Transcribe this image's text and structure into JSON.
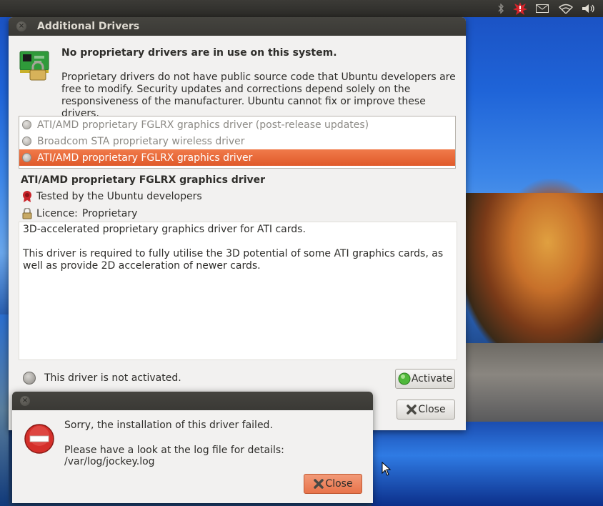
{
  "main_window": {
    "title": "Additional Drivers",
    "headline": "No proprietary drivers are in use on this system.",
    "description": "Proprietary drivers do not have public source code that Ubuntu developers are free to modify. Security updates and corrections depend solely on the responsiveness of the manufacturer. Ubuntu cannot fix or improve these drivers.",
    "drivers": [
      {
        "label": "ATI/AMD proprietary FGLRX graphics driver (post-release updates)",
        "selected": false
      },
      {
        "label": "Broadcom STA proprietary wireless driver",
        "selected": false
      },
      {
        "label": "ATI/AMD proprietary FGLRX graphics driver",
        "selected": true
      }
    ],
    "detail": {
      "title": "ATI/AMD proprietary FGLRX graphics driver",
      "tested": "Tested by the Ubuntu developers",
      "licence_label": "Licence:",
      "licence_value": "Proprietary",
      "paragraph1": "3D-accelerated proprietary graphics driver for ATI cards.",
      "paragraph2": "This driver is required to fully utilise the 3D potential of some ATI graphics cards, as well as provide 2D acceleration of newer cards."
    },
    "status_text": "This driver is not activated.",
    "activate_label": "Activate",
    "close_label": "Close"
  },
  "error_dialog": {
    "message": "Sorry, the installation of this driver failed.",
    "detail": "Please have a look at the log file for details: /var/log/jockey.log",
    "close_label": "Close"
  },
  "tray_icons": [
    "bluetooth-icon",
    "update-alert-icon",
    "mail-icon",
    "wifi-icon",
    "volume-icon"
  ],
  "colors": {
    "selection": "#e8643a",
    "titlebar": "#3c3b37",
    "window_bg": "#f2f1f0",
    "error_red": "#d42f2a"
  }
}
